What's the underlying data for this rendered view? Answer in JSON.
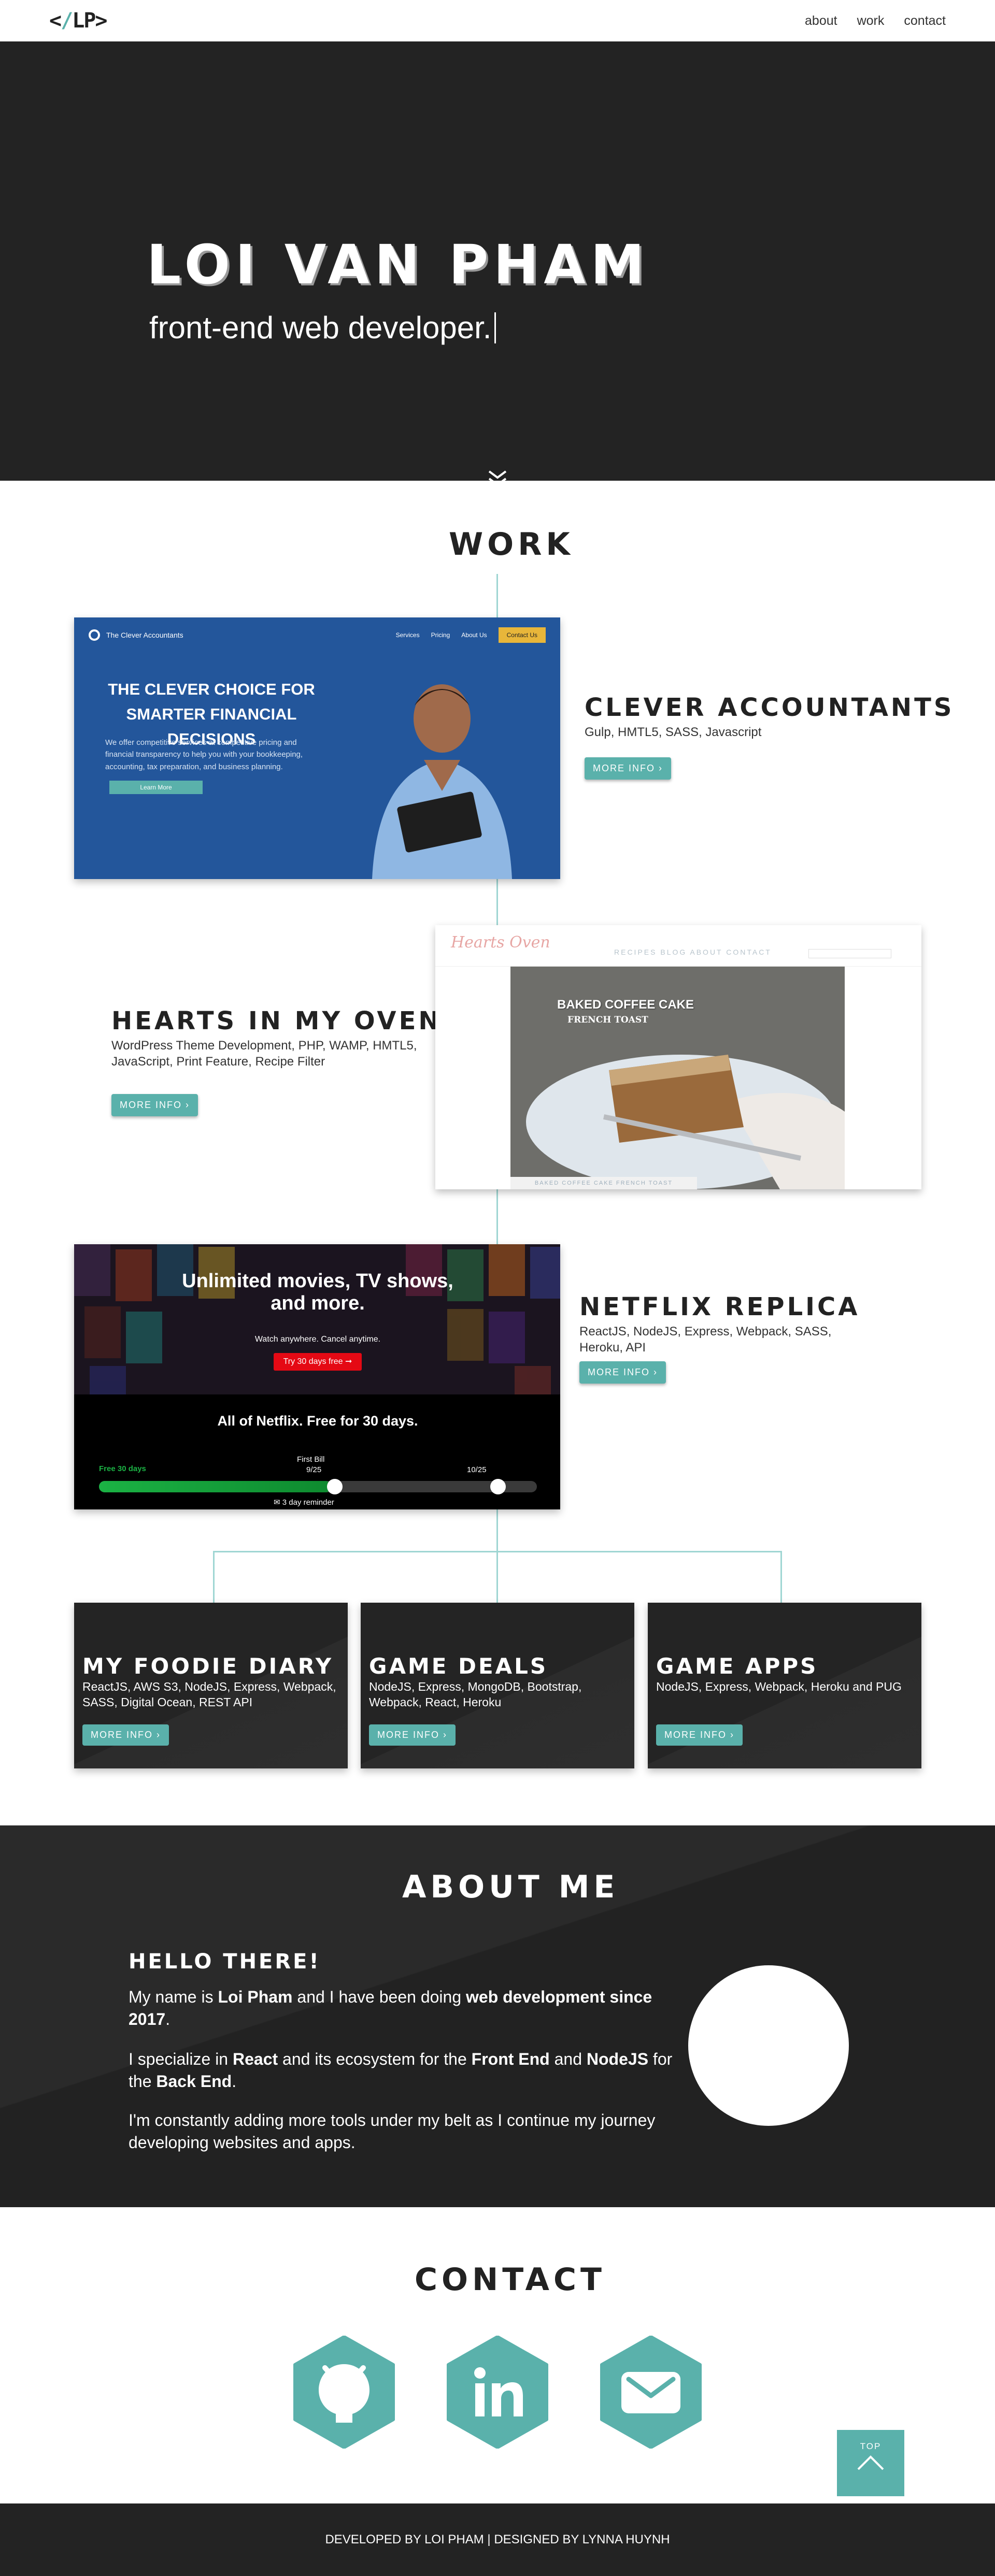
{
  "nav": {
    "logo_open": "<",
    "logo_slash": "/",
    "logo_close": "LP>",
    "links": [
      "about",
      "work",
      "contact"
    ]
  },
  "hero": {
    "name": "LOI VAN PHAM",
    "tagline": "front-end web developer."
  },
  "work": {
    "title": "WORK",
    "projects": [
      {
        "title": "CLEVER ACCOUNTANTS",
        "tech": "Gulp, HMTL5, SASS, Javascript",
        "button": "MORE INFO ›",
        "preview": {
          "brand": "The Clever Accountants",
          "links": [
            "Services",
            "Pricing",
            "About Us"
          ],
          "cta": "Contact Us",
          "headline": "THE CLEVER CHOICE FOR SMARTER FINANCIAL DECISIONS",
          "body": "We offer competitive services at competitive pricing and financial transparency to help you with your bookkeeping, accounting, tax preparation, and business planning.",
          "learn_more": "Learn More"
        }
      },
      {
        "title": "HEARTS IN MY OVEN",
        "tech": "WordPress Theme Development, PHP, WAMP, HMTL5, JavaScript, Print Feature, Recipe Filter",
        "button": "MORE INFO ›",
        "preview": {
          "logo": "Hearts Oven",
          "menu": "RECIPES BLOG ABOUT CONTACT",
          "photo_title": "BAKED COFFEE CAKE",
          "photo_sub": "FRENCH TOAST",
          "strip": "BAKED COFFEE CAKE FRENCH TOAST"
        }
      },
      {
        "title": "NETFLIX REPLICA",
        "tech": "ReactJS, NodeJS, Express, Webpack, SASS, Heroku, API",
        "button": "MORE INFO ›",
        "preview": {
          "headline": "Unlimited movies, TV shows, and more.",
          "sub": "Watch anywhere. Cancel anytime.",
          "try_button": "Try 30 days free ➞",
          "all_of": "All of Netflix. Free for 30 days.",
          "free_label": "Free 30 days",
          "first_bill": "First Bill",
          "date1": "9/25",
          "date2": "10/25",
          "reminder": "✉  3 day reminder",
          "progress": 0.53
        }
      }
    ],
    "mini_projects": [
      {
        "title": "MY FOODIE DIARY",
        "tech": "ReactJS, AWS S3,  NodeJS, Express, Webpack, SASS, Digital Ocean, REST API",
        "button": "MORE INFO ›"
      },
      {
        "title": "GAME DEALS",
        "tech": "NodeJS, Express, MongoDB, Bootstrap, Webpack, React, Heroku",
        "button": "MORE INFO ›"
      },
      {
        "title": "GAME APPS",
        "tech": "NodeJS, Express, Webpack, Heroku and PUG",
        "button": "MORE INFO ›"
      }
    ]
  },
  "about": {
    "title": "ABOUT ME",
    "hello": "HELLO THERE!",
    "p1_a": "My name is ",
    "p1_name": "Loi Pham",
    "p1_b": " and I have been doing ",
    "p1_strong": "web development since 2017",
    "p1_c": ".",
    "p2_a": "I specialize in ",
    "p2_react": "React",
    "p2_b": " and its ecosystem for the ",
    "p2_front": "Front End",
    "p2_c": " and ",
    "p2_node": "NodeJS",
    "p2_d": " for the ",
    "p2_back": "Back End",
    "p2_e": ".",
    "p3": "I'm constantly adding more tools under my belt as I continue my journey developing websites and apps."
  },
  "contact": {
    "title": "CONTACT",
    "icons": [
      "github-icon",
      "linkedin-icon",
      "mail-icon"
    ],
    "top_label": "TOP"
  },
  "footer": {
    "text": "DEVELOPED BY LOI PHAM | DESIGNED BY LYNNA HUYNH"
  },
  "colors": {
    "accent": "#5ab1ab",
    "dark": "#232323",
    "timeline": "#9fd6d3"
  }
}
